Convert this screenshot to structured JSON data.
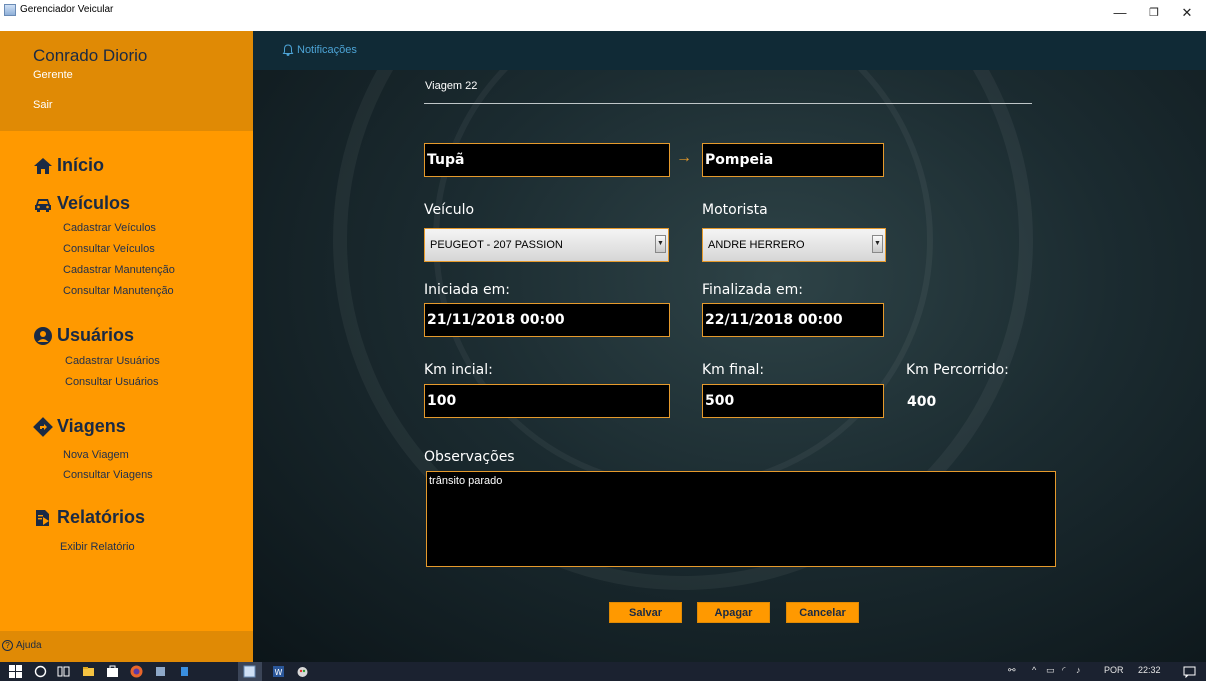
{
  "window": {
    "title": "Gerenciador Veicular",
    "minimize": "—",
    "maximize": "❐",
    "close": "✕"
  },
  "user": {
    "name": "Conrado Diorio",
    "role": "Gerente",
    "logout": "Sair"
  },
  "nav": {
    "home": "Início",
    "vehicles": {
      "label": "Veículos",
      "items": [
        "Cadastrar Veículos",
        "Consultar Veículos",
        "Cadastrar Manutenção",
        "Consultar Manutenção"
      ]
    },
    "users": {
      "label": "Usuários",
      "items": [
        "Cadastrar Usuários",
        "Consultar Usuários"
      ]
    },
    "trips": {
      "label": "Viagens",
      "items": [
        "Nova Viagem",
        "Consultar Viagens"
      ]
    },
    "reports": {
      "label": "Relatórios",
      "items": [
        "Exibir Relatório"
      ]
    }
  },
  "help": {
    "label": "Ajuda"
  },
  "topbar": {
    "notifications": "Notificações"
  },
  "trip": {
    "title": "Viagem 22",
    "origin": "Tupã",
    "destination": "Pompeia",
    "vehicle_label": "Veículo",
    "vehicle_value": "PEUGEOT  - 207 PASSION",
    "driver_label": "Motorista",
    "driver_value": "ANDRE HERRERO",
    "started_label": "Iniciada em:",
    "started_value": "21/11/2018 00:00",
    "finished_label": "Finalizada em:",
    "finished_value": "22/11/2018 00:00",
    "km_start_label": "Km incial:",
    "km_start_value": "100",
    "km_end_label": "Km final:",
    "km_end_value": "500",
    "km_total_label": "Km Percorrido:",
    "km_total_value": "400",
    "notes_label": "Observações",
    "notes_value": "trânsito parado"
  },
  "buttons": {
    "save": "Salvar",
    "delete": "Apagar",
    "cancel": "Cancelar"
  },
  "taskbar": {
    "language": "POR",
    "time": "22:32"
  },
  "colors": {
    "sidebar": "#ff9900",
    "accent_border": "#e69a2c",
    "topbar": "#102a36",
    "notif_text": "#4da4d6"
  }
}
